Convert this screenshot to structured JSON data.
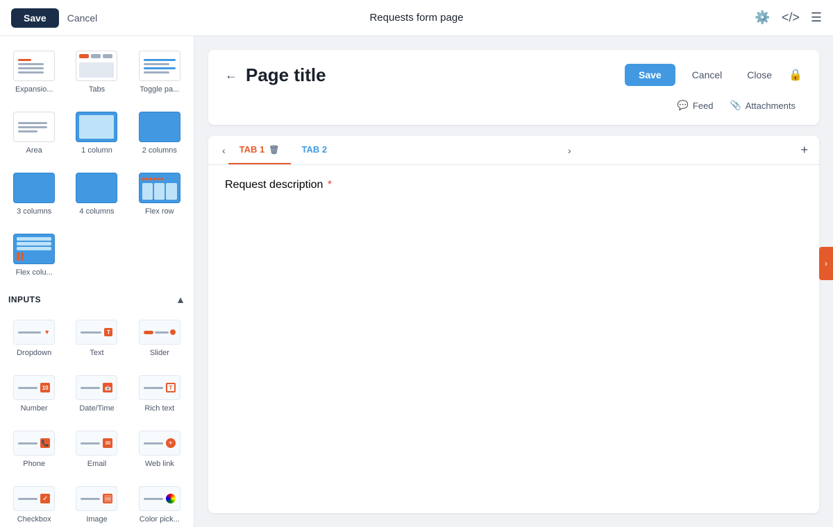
{
  "topbar": {
    "save_label": "Save",
    "cancel_label": "Cancel",
    "title": "Requests form page"
  },
  "sidebar": {
    "layouts_section": {
      "items": [
        {
          "id": "expansion",
          "label": "Expansio..."
        },
        {
          "id": "tabs",
          "label": "Tabs"
        },
        {
          "id": "toggle",
          "label": "Toggle pa..."
        },
        {
          "id": "area",
          "label": "Area"
        },
        {
          "id": "1col",
          "label": "1 column"
        },
        {
          "id": "2col",
          "label": "2 columns"
        },
        {
          "id": "3col",
          "label": "3 columns"
        },
        {
          "id": "4col",
          "label": "4 columns"
        },
        {
          "id": "flexrow",
          "label": "Flex row"
        },
        {
          "id": "flexcol",
          "label": "Flex colu..."
        }
      ]
    },
    "inputs_section": {
      "title": "INPUTS",
      "items": [
        {
          "id": "dropdown",
          "label": "Dropdown"
        },
        {
          "id": "text",
          "label": "Text"
        },
        {
          "id": "slider",
          "label": "Slider"
        },
        {
          "id": "number",
          "label": "Number"
        },
        {
          "id": "datetime",
          "label": "Date/Time"
        },
        {
          "id": "richtext",
          "label": "Rich text"
        },
        {
          "id": "phone",
          "label": "Phone"
        },
        {
          "id": "email",
          "label": "Email"
        },
        {
          "id": "weblink",
          "label": "Web link"
        },
        {
          "id": "checkbox",
          "label": "Checkbox"
        },
        {
          "id": "image",
          "label": "Image"
        },
        {
          "id": "colorpick",
          "label": "Color pick..."
        }
      ]
    }
  },
  "page": {
    "back_label": "←",
    "title": "Page title",
    "save_label": "Save",
    "cancel_label": "Cancel",
    "close_label": "Close",
    "feed_label": "Feed",
    "attachments_label": "Attachments"
  },
  "tabs": {
    "tab1_label": "TAB 1",
    "tab2_label": "TAB 2",
    "add_label": "+",
    "field_label": "Request description",
    "field_required": "*"
  }
}
